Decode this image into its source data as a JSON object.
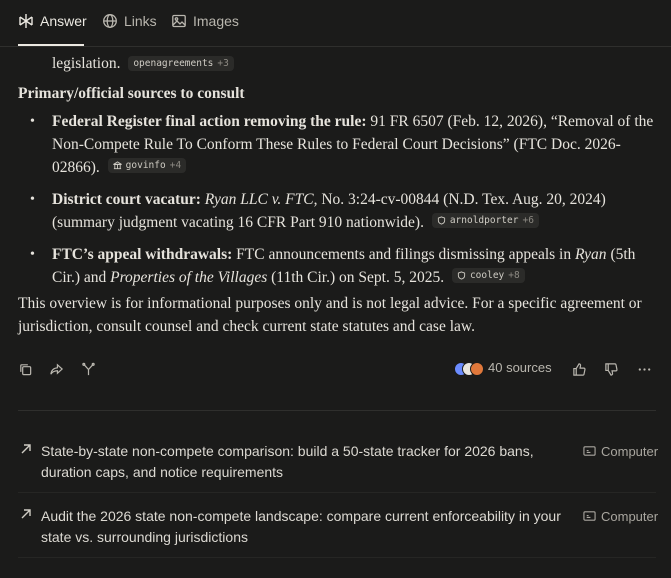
{
  "tabs": [
    {
      "label": "Answer",
      "icon": "answer-logo-icon"
    },
    {
      "label": "Links",
      "icon": "globe-icon"
    },
    {
      "label": "Images",
      "icon": "image-icon"
    }
  ],
  "answer": {
    "line1": {
      "text": "legislation.",
      "cite": "openagreements",
      "more": "+3"
    },
    "heading": "Primary/official sources to consult",
    "bullets": [
      {
        "bold": "Federal Register final action removing the rule:",
        "text": " 91 FR 6507 (Feb. 12, 2026), “Removal of the Non-Compete Rule To Conform These Rules to Federal Court Decisions” (FTC Doc. 2026-02866).",
        "cite": "govinfo",
        "more": "+4"
      },
      {
        "bold": "District court vacatur:",
        "italic1": "Ryan LLC v. FTC",
        "text1": ", No. 3:24-cv-00844 (N.D. Tex. Aug. 20, 2024) (summary judgment vacating 16 CFR Part 910 nationwide).",
        "cite": "arnoldporter",
        "more": "+6"
      },
      {
        "bold": "FTC’s appeal withdrawals:",
        "text1": " FTC announcements and filings dismissing appeals in ",
        "italic1": "Ryan",
        "text2": " (5th Cir.) and ",
        "italic2": "Properties of the Villages",
        "text3": " (11th Cir.) on Sept. 5, 2025.",
        "cite": "cooley",
        "more": "+8"
      }
    ],
    "disclaimer": "This overview is for informational purposes only and is not legal advice. For a specific agreement or jurisdiction, consult counsel and check current state statutes and case law."
  },
  "actions": {
    "sources_label": "40 sources",
    "colors": [
      "#6b8cff",
      "#e9e6de",
      "#e0783b"
    ]
  },
  "related": [
    {
      "text": "State-by-state non-compete comparison: build a 50-state tracker for 2026 bans, duration caps, and notice requirements",
      "mode": "Computer"
    },
    {
      "text": "Audit the 2026 state non-compete landscape: compare current enforceability in your state vs. surrounding jurisdictions",
      "mode": "Computer"
    }
  ]
}
